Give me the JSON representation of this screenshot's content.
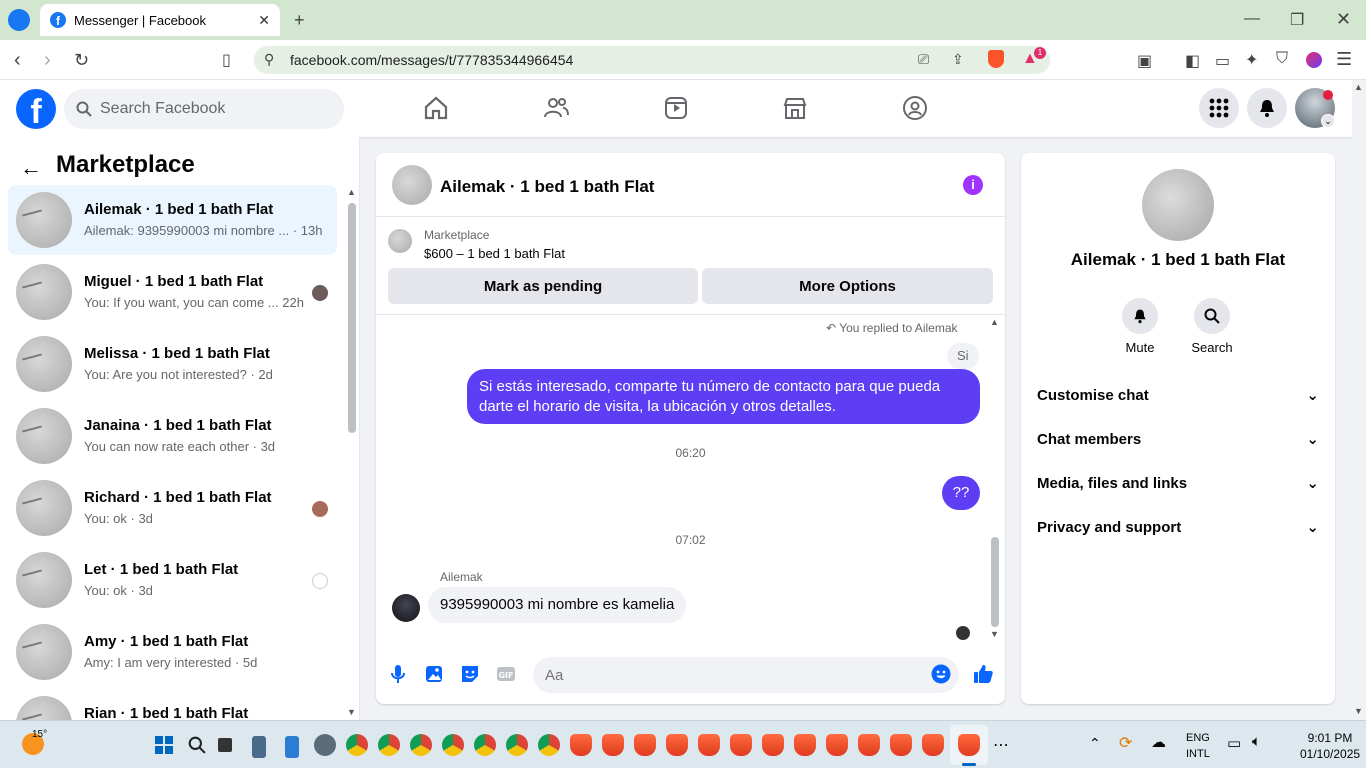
{
  "browser": {
    "tab_title": "Messenger | Facebook",
    "url": "facebook.com/messages/t/777835344966454",
    "brave_badge": "1"
  },
  "fb": {
    "search_placeholder": "Search Facebook",
    "logo_letter": "f"
  },
  "left": {
    "title": "Marketplace",
    "conversations": [
      {
        "name": "Ailemak · 1 bed 1 bath Flat",
        "preview": "Ailemak: 9395990003 mi nombre ... · 13h"
      },
      {
        "name": "Miguel · 1 bed 1 bath Flat",
        "preview": "You: If you want, you can come ... 22h"
      },
      {
        "name": "Melissa · 1 bed 1 bath Flat",
        "preview": "You: Are you not interested? · 2d"
      },
      {
        "name": "Janaina · 1 bed 1 bath Flat",
        "preview": "You can now rate each other · 3d"
      },
      {
        "name": "Richard · 1 bed 1 bath Flat",
        "preview": "You: ok · 3d"
      },
      {
        "name": "Let · 1 bed 1 bath Flat",
        "preview": "You: ok · 3d"
      },
      {
        "name": "Amy · 1 bed 1 bath Flat",
        "preview": "Amy: I am very interested · 5d"
      },
      {
        "name": "Rian · 1 bed 1 bath Flat",
        "preview": ""
      }
    ]
  },
  "chat": {
    "title": "Ailemak · 1 bed 1 bath Flat",
    "info_glyph": "i",
    "marketplace_label": "Marketplace",
    "listing": "$600 – 1 bed 1 bath Flat",
    "btn_pending": "Mark as pending",
    "btn_more": "More Options",
    "replied_note": "You replied to Ailemak",
    "quoted": "Si",
    "msg_out_1": "Si estás interesado, comparte tu número de contacto para que pueda darte el horario de visita, la ubicación y otros detalles.",
    "time_1": "06:20",
    "msg_out_2": "??",
    "time_2": "07:02",
    "sender": "Ailemak",
    "msg_in": "9395990003 mi nombre es kamelia",
    "input_placeholder": "Aa"
  },
  "right": {
    "name": "Ailemak · 1 bed 1 bath Flat",
    "mute_label": "Mute",
    "search_label": "Search",
    "rows": [
      "Customise chat",
      "Chat members",
      "Media, files and links",
      "Privacy and support"
    ]
  },
  "taskbar": {
    "temp": "15°",
    "lang_1": "ENG",
    "lang_2": "INTL",
    "time": "9:01 PM",
    "date": "01/10/2025"
  },
  "colors": {
    "fb_blue": "#0866ff",
    "bubble_purple": "#5e3ef5",
    "info_purple": "#a033ff",
    "active_row": "#ebf5ff"
  }
}
